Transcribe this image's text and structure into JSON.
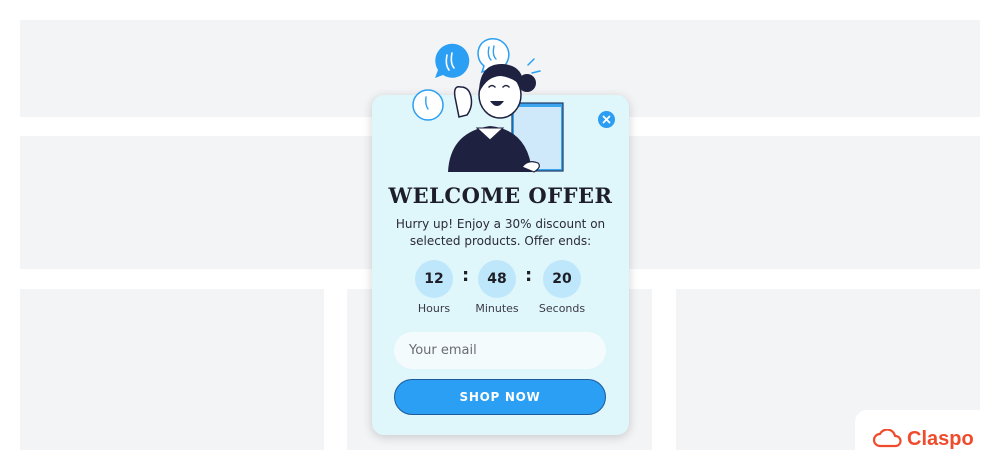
{
  "popup": {
    "title": "WELCOME OFFER",
    "description": "Hurry up! Enjoy a 30% discount on selected products. Offer ends:",
    "countdown": [
      {
        "value": "12",
        "label": "Hours"
      },
      {
        "value": "48",
        "label": "Minutes"
      },
      {
        "value": "20",
        "label": "Seconds"
      }
    ],
    "separator": ":",
    "email_placeholder": "Your email",
    "button_label": "SHOP NOW",
    "close_icon": "close-icon"
  },
  "brand": {
    "name": "Claspo",
    "icon": "cloud-logo-icon"
  },
  "colors": {
    "popup_bg": "#dff6fb",
    "accent": "#2a9ff3",
    "brand": "#ef4b2d",
    "placeholder_block": "#f3f4f6"
  }
}
